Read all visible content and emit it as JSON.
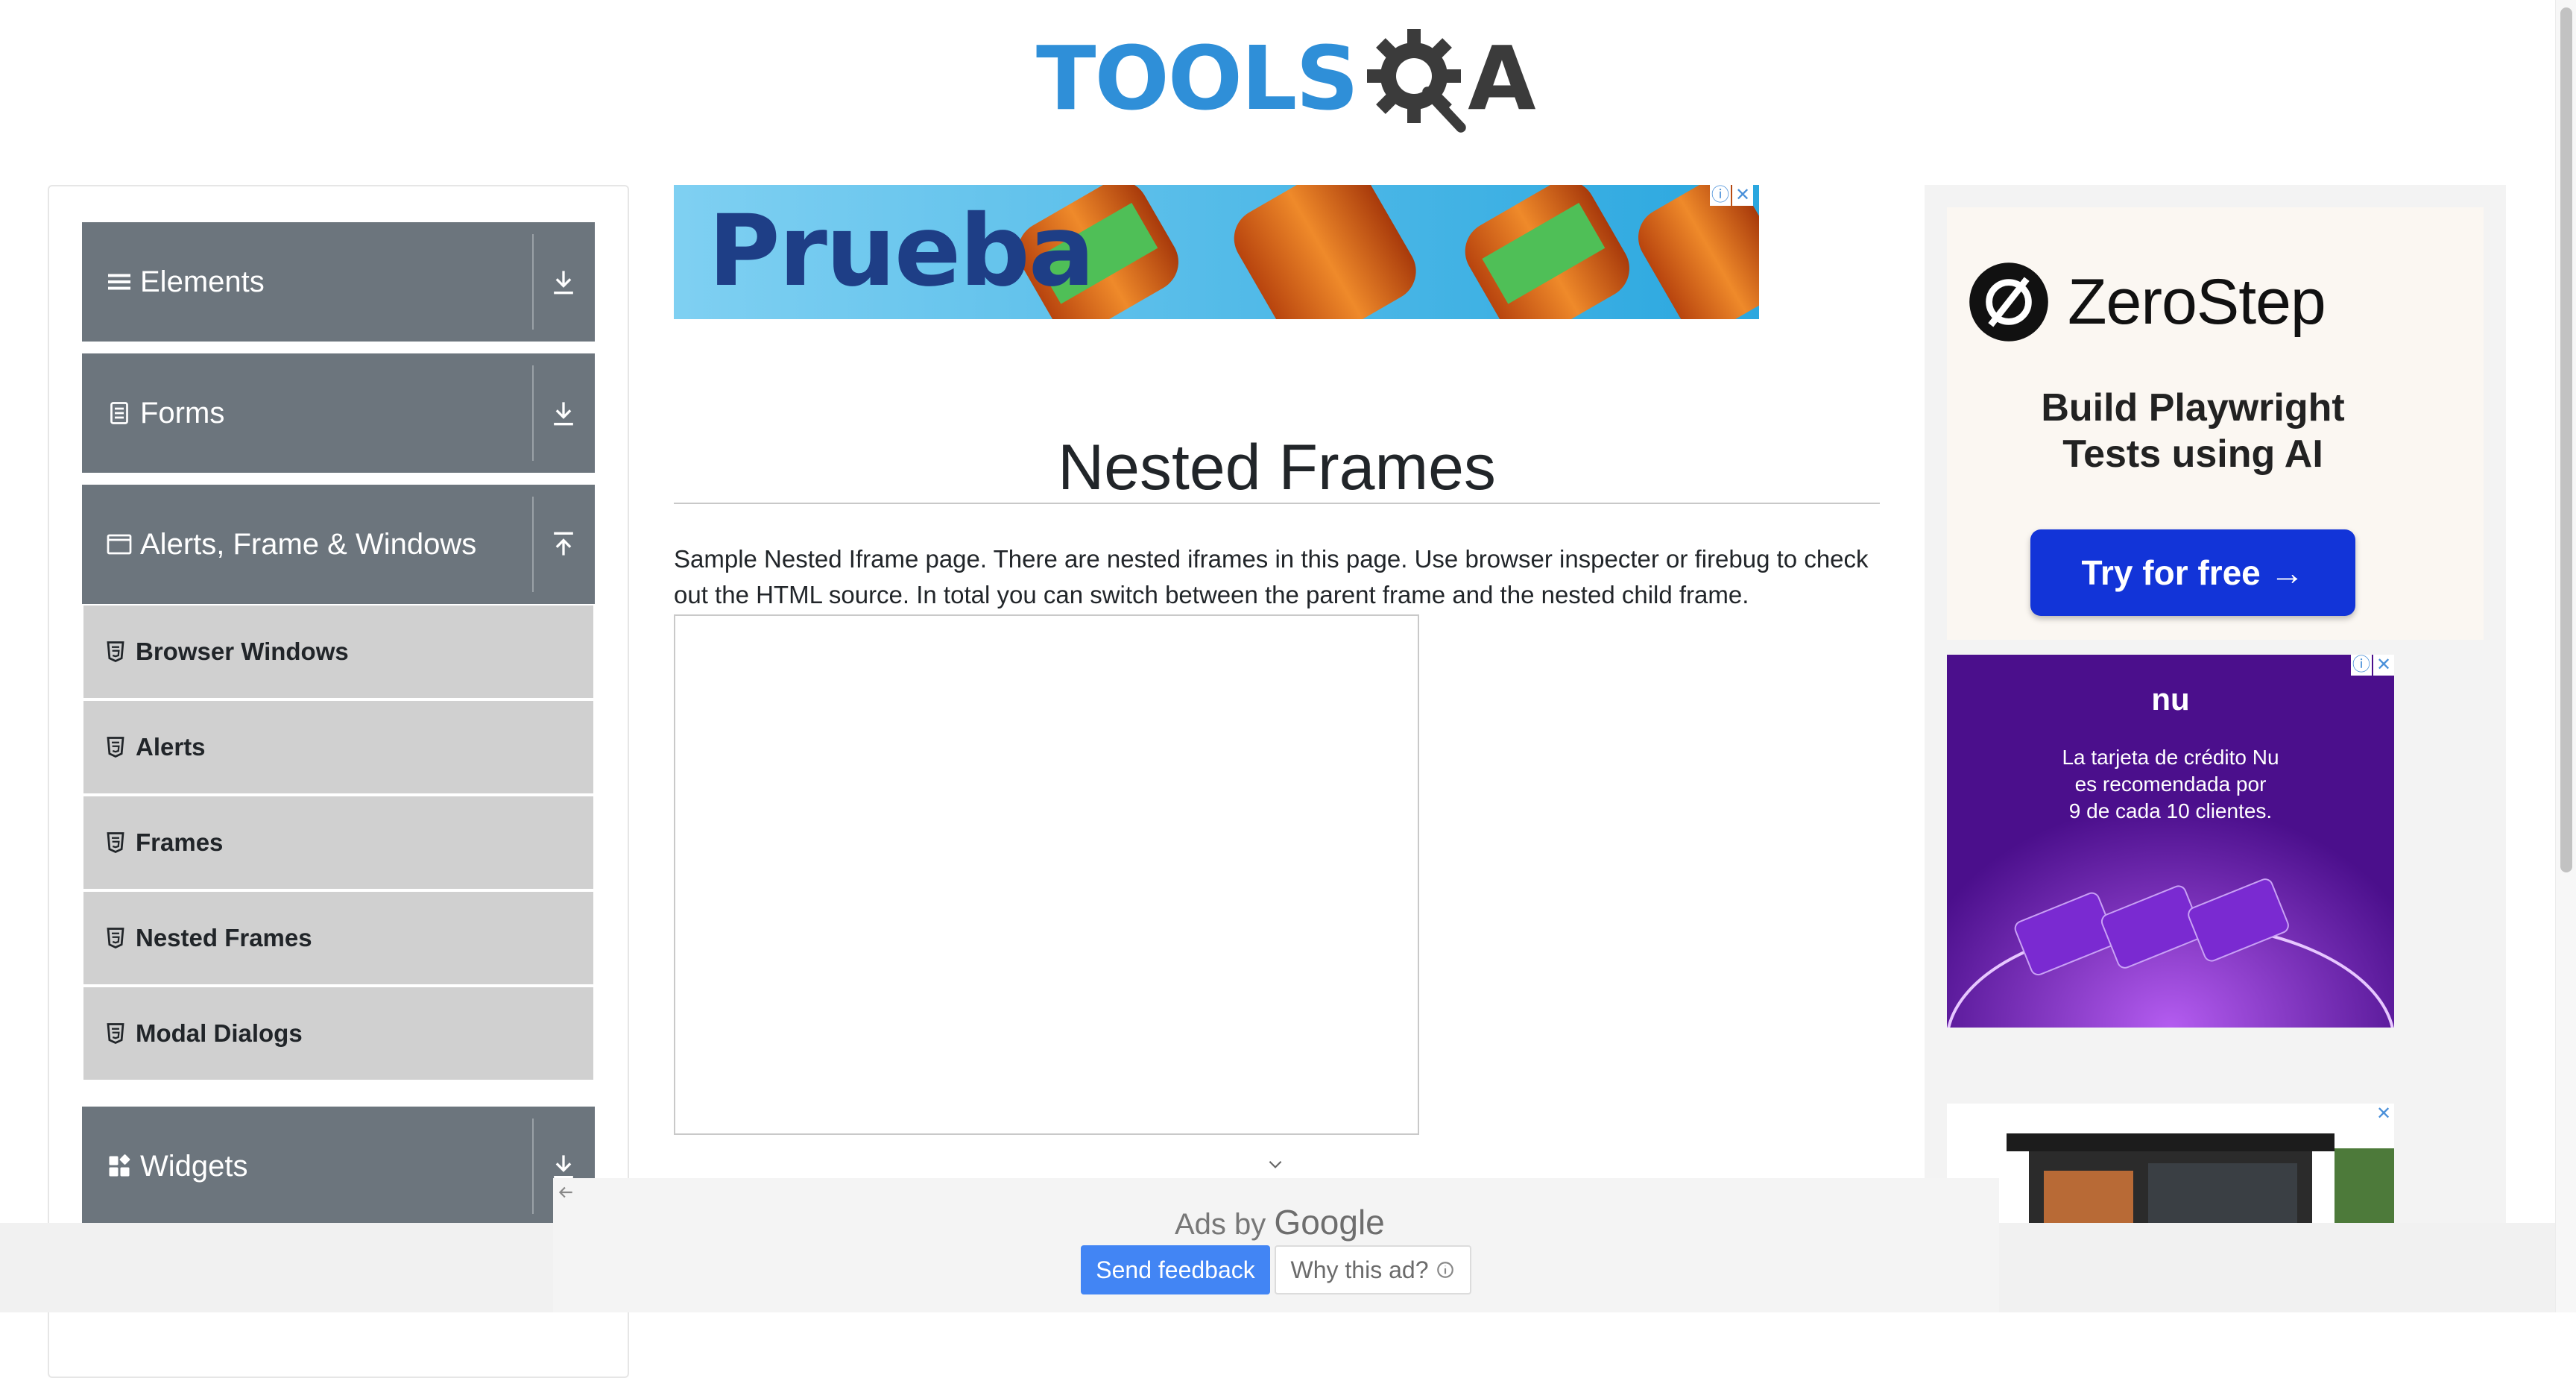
{
  "header": {
    "logo_tools": "TOOLS",
    "logo_a": "A"
  },
  "sidebar": {
    "groups": [
      {
        "label": "Elements",
        "icon": "hamburger-icon",
        "arrow": "download-arrow-icon"
      },
      {
        "label": "Forms",
        "icon": "form-icon",
        "arrow": "download-arrow-icon"
      },
      {
        "label": "Alerts, Frame & Windows",
        "icon": "window-icon",
        "arrow": "upload-arrow-icon",
        "expanded": true
      },
      {
        "label": "Widgets",
        "icon": "widgets-icon",
        "arrow": "download-arrow-icon"
      }
    ],
    "items": [
      {
        "label": "Browser Windows"
      },
      {
        "label": "Alerts"
      },
      {
        "label": "Frames"
      },
      {
        "label": "Nested Frames"
      },
      {
        "label": "Modal Dialogs"
      }
    ]
  },
  "top_ad": {
    "headline": "Prueba"
  },
  "main": {
    "title": "Nested Frames",
    "description": "Sample Nested Iframe page. There are nested iframes in this page. Use browser inspecter or firebug to check out the HTML source. In total you can switch between the parent frame and the nested child frame."
  },
  "right_ads": {
    "zerostep": {
      "brand": "ZeroStep",
      "tagline_line1": "Build Playwright",
      "tagline_line2": "Tests using AI",
      "cta": "Try for free →"
    },
    "nu": {
      "brand": "nu",
      "line1": "La tarjeta de crédito Nu",
      "line2": "es recomendada por",
      "line3": "9 de cada 10 clientes."
    }
  },
  "bottom_ad": {
    "ads_by": "Ads by",
    "google": "Google",
    "send_feedback": "Send feedback",
    "why_this_ad": "Why this ad?"
  },
  "colors": {
    "sidebar_header": "#6c757d",
    "sidebar_item": "#d0d0d0",
    "logo_blue": "#2f8fd8",
    "cta_blue": "#1234d8",
    "feedback_blue": "#4285f4",
    "nu_purple": "#4b0f8c"
  }
}
